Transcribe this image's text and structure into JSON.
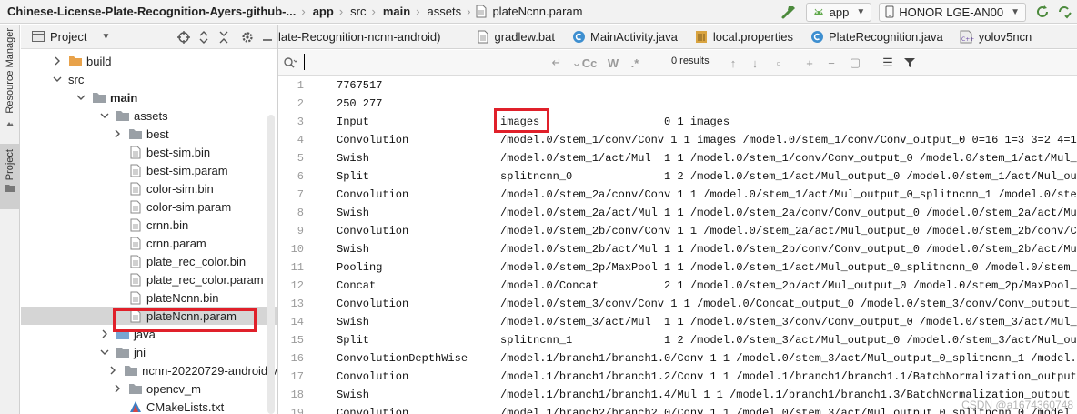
{
  "navbar": {
    "project": "Chinese-License-Plate-Recognition-Ayers-github-...",
    "crumbs": [
      "app",
      "src",
      "main",
      "assets"
    ],
    "file": "plateNcnn.param",
    "run_config": "app",
    "device": "HONOR LGE-AN00"
  },
  "stripe": {
    "resource_manager": "Resource Manager",
    "project": "Project"
  },
  "project_panel": {
    "title": "Project",
    "tree": [
      {
        "label": "build",
        "type": "folder-orange",
        "expand": "collapsed",
        "depth": 2
      },
      {
        "label": "src",
        "type": "none",
        "expand": "expanded",
        "depth": 2
      },
      {
        "label": "main",
        "type": "folder-gray",
        "expand": "expanded",
        "depth": 3,
        "bold": true
      },
      {
        "label": "assets",
        "type": "folder-gray",
        "expand": "expanded",
        "depth": 4
      },
      {
        "label": "best",
        "type": "folder-gray",
        "expand": "collapsed",
        "depth": 5
      },
      {
        "label": "best-sim.bin",
        "type": "file",
        "expand": "none",
        "depth": 5
      },
      {
        "label": "best-sim.param",
        "type": "file",
        "expand": "none",
        "depth": 5
      },
      {
        "label": "color-sim.bin",
        "type": "file",
        "expand": "none",
        "depth": 5
      },
      {
        "label": "color-sim.param",
        "type": "file",
        "expand": "none",
        "depth": 5
      },
      {
        "label": "crnn.bin",
        "type": "file",
        "expand": "none",
        "depth": 5
      },
      {
        "label": "crnn.param",
        "type": "file",
        "expand": "none",
        "depth": 5
      },
      {
        "label": "plate_rec_color.bin",
        "type": "file",
        "expand": "none",
        "depth": 5
      },
      {
        "label": "plate_rec_color.param",
        "type": "file",
        "expand": "none",
        "depth": 5
      },
      {
        "label": "plateNcnn.bin",
        "type": "file",
        "expand": "none",
        "depth": 5
      },
      {
        "label": "plateNcnn.param",
        "type": "file",
        "expand": "none",
        "depth": 5,
        "selected": true
      },
      {
        "label": "java",
        "type": "folder-blue",
        "expand": "collapsed",
        "depth": 4
      },
      {
        "label": "jni",
        "type": "folder-gray",
        "expand": "expanded",
        "depth": 4
      },
      {
        "label": "ncnn-20220729-android-v",
        "type": "folder-gray",
        "expand": "collapsed",
        "depth": 5
      },
      {
        "label": "opencv_m",
        "type": "folder-gray",
        "expand": "collapsed",
        "depth": 5
      },
      {
        "label": "CMakeLists.txt",
        "type": "cmake",
        "expand": "none",
        "depth": 5
      }
    ]
  },
  "tabs": [
    {
      "label": "late-Recognition-ncnn-android)",
      "icon": "none"
    },
    {
      "label": "gradlew.bat",
      "icon": "file-icon"
    },
    {
      "label": "MainActivity.java",
      "icon": "class-icon"
    },
    {
      "label": "local.properties",
      "icon": "properties-icon"
    },
    {
      "label": "PlateRecognition.java",
      "icon": "class-icon"
    },
    {
      "label": "yolov5ncn",
      "icon": "cpp-icon"
    }
  ],
  "search": {
    "value": "",
    "results": "0 results"
  },
  "editor": {
    "lines": [
      {
        "n": "1",
        "t": "7767517"
      },
      {
        "n": "2",
        "t": "250 277"
      },
      {
        "n": "3",
        "t": "Input                    images                   0 1 images"
      },
      {
        "n": "4",
        "t": "Convolution              /model.0/stem_1/conv/Conv 1 1 images /model.0/stem_1/conv/Conv_output_0 0=16 1=3 3=2 4=1"
      },
      {
        "n": "5",
        "t": "Swish                    /model.0/stem_1/act/Mul  1 1 /model.0/stem_1/conv/Conv_output_0 /model.0/stem_1/act/Mul_"
      },
      {
        "n": "6",
        "t": "Split                    splitncnn_0              1 2 /model.0/stem_1/act/Mul_output_0 /model.0/stem_1/act/Mul_ou"
      },
      {
        "n": "7",
        "t": "Convolution              /model.0/stem_2a/conv/Conv 1 1 /model.0/stem_1/act/Mul_output_0_splitncnn_1 /model.0/ste"
      },
      {
        "n": "8",
        "t": "Swish                    /model.0/stem_2a/act/Mul 1 1 /model.0/stem_2a/conv/Conv_output_0 /model.0/stem_2a/act/Mu"
      },
      {
        "n": "9",
        "t": "Convolution              /model.0/stem_2b/conv/Conv 1 1 /model.0/stem_2a/act/Mul_output_0 /model.0/stem_2b/conv/C"
      },
      {
        "n": "10",
        "t": "Swish                    /model.0/stem_2b/act/Mul 1 1 /model.0/stem_2b/conv/Conv_output_0 /model.0/stem_2b/act/Mu"
      },
      {
        "n": "11",
        "t": "Pooling                  /model.0/stem_2p/MaxPool 1 1 /model.0/stem_1/act/Mul_output_0_splitncnn_0 /model.0/stem_"
      },
      {
        "n": "12",
        "t": "Concat                   /model.0/Concat          2 1 /model.0/stem_2b/act/Mul_output_0 /model.0/stem_2p/MaxPool_"
      },
      {
        "n": "13",
        "t": "Convolution              /model.0/stem_3/conv/Conv 1 1 /model.0/Concat_output_0 /model.0/stem_3/conv/Conv_output_"
      },
      {
        "n": "14",
        "t": "Swish                    /model.0/stem_3/act/Mul  1 1 /model.0/stem_3/conv/Conv_output_0 /model.0/stem_3/act/Mul_"
      },
      {
        "n": "15",
        "t": "Split                    splitncnn_1              1 2 /model.0/stem_3/act/Mul_output_0 /model.0/stem_3/act/Mul_ou"
      },
      {
        "n": "16",
        "t": "ConvolutionDepthWise     /model.1/branch1/branch1.0/Conv 1 1 /model.0/stem_3/act/Mul_output_0_splitncnn_1 /model."
      },
      {
        "n": "17",
        "t": "Convolution              /model.1/branch1/branch1.2/Conv 1 1 /model.1/branch1/branch1.1/BatchNormalization_output"
      },
      {
        "n": "18",
        "t": "Swish                    /model.1/branch1/branch1.4/Mul 1 1 /model.1/branch1/branch1.3/BatchNormalization_output"
      },
      {
        "n": "19",
        "t": "Convolution              /model.1/branch2/branch2.0/Conv 1 1 /model.0/stem_3/act/Mul_output_0_splitncnn_0 /model."
      }
    ]
  },
  "watermark": "CSDN @a1674360748"
}
